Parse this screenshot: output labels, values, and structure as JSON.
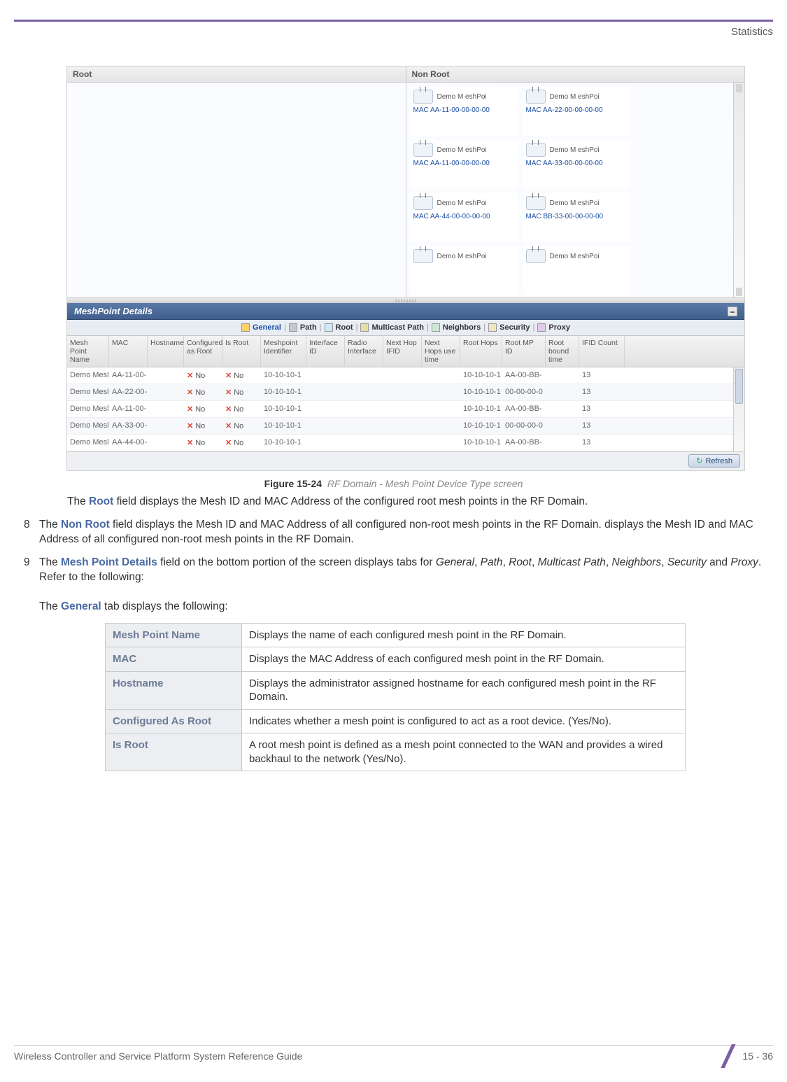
{
  "header": {
    "section": "Statistics"
  },
  "screenshot": {
    "panes": {
      "root": {
        "title": "Root"
      },
      "nonroot": {
        "title": "Non Root",
        "cards": [
          {
            "name": "Demo M eshPoi",
            "mac": "MAC AA-11-00-00-00-00"
          },
          {
            "name": "Demo M eshPoi",
            "mac": "MAC AA-22-00-00-00-00"
          },
          {
            "name": "Demo M eshPoi",
            "mac": "MAC AA-11-00-00-00-00"
          },
          {
            "name": "Demo M eshPoi",
            "mac": "MAC AA-33-00-00-00-00"
          },
          {
            "name": "Demo M eshPoi",
            "mac": "MAC AA-44-00-00-00-00"
          },
          {
            "name": "Demo M eshPoi",
            "mac": "MAC BB-33-00-00-00-00"
          },
          {
            "name": "Demo M eshPoi",
            "mac": ""
          },
          {
            "name": "Demo M eshPoi",
            "mac": ""
          }
        ]
      }
    },
    "details": {
      "title": "MeshPoint Details",
      "tabs": {
        "general": "General",
        "path": "Path",
        "root": "Root",
        "multicast": "Multicast Path",
        "neighbors": "Neighbors",
        "security": "Security",
        "proxy": "Proxy"
      },
      "columns": [
        "Mesh Point Name",
        "MAC",
        "Hostname",
        "Configured as Root",
        "Is Root",
        "Meshpoint Identifier",
        "Interface ID",
        "Radio Interface",
        "Next Hop IFID",
        "Next Hops use time",
        "Root Hops",
        "Root MP ID",
        "Root bound time",
        "IFID Count"
      ],
      "rows": [
        {
          "name": "Demo Mesl",
          "mac": "AA-11-00-",
          "cfg": "No",
          "isroot": "No",
          "mpid": "10-10-10-1",
          "rhops": "10-10-10-1",
          "rmp": "AA-00-BB-",
          "ifid": "13"
        },
        {
          "name": "Demo Mesl",
          "mac": "AA-22-00-",
          "cfg": "No",
          "isroot": "No",
          "mpid": "10-10-10-1",
          "rhops": "10-10-10-1",
          "rmp": "00-00-00-0",
          "ifid": "13"
        },
        {
          "name": "Demo Mesl",
          "mac": "AA-11-00-",
          "cfg": "No",
          "isroot": "No",
          "mpid": "10-10-10-1",
          "rhops": "10-10-10-1",
          "rmp": "AA-00-BB-",
          "ifid": "13"
        },
        {
          "name": "Demo Mesl",
          "mac": "AA-33-00-",
          "cfg": "No",
          "isroot": "No",
          "mpid": "10-10-10-1",
          "rhops": "10-10-10-1",
          "rmp": "00-00-00-0",
          "ifid": "13"
        },
        {
          "name": "Demo Mesl",
          "mac": "AA-44-00-",
          "cfg": "No",
          "isroot": "No",
          "mpid": "10-10-10-1",
          "rhops": "10-10-10-1",
          "rmp": "AA-00-BB-",
          "ifid": "13"
        }
      ],
      "refresh": "Refresh"
    }
  },
  "caption": {
    "label": "Figure 15-24",
    "text": "RF Domain - Mesh Point Device Type screen"
  },
  "paras": {
    "p7": {
      "pre": "The ",
      "b": "Root",
      "post": " field displays the Mesh ID and MAC Address of the configured root mesh points in the RF Domain."
    },
    "p8": {
      "n": "8",
      "pre": "The ",
      "b": "Non Root",
      "post": " field displays the Mesh ID and MAC Address of all configured non-root mesh points in the RF Domain. displays the Mesh ID and MAC Address of all configured non-root mesh points in the RF Domain."
    },
    "p9": {
      "n": "9",
      "pre": "The ",
      "b": "Mesh Point Details",
      "mid": " field on the bottom portion of the screen displays tabs for ",
      "i1": "General",
      "c1": ", ",
      "i2": "Path",
      "c2": ", ",
      "i3": "Root",
      "c3": ", ",
      "i4": "Multicast Path",
      "c4": ", ",
      "i5": "Neighbors",
      "c5": ", ",
      "i6": "Security",
      "c6": " and ",
      "i7": "Proxy",
      "post": ". Refer to the following:"
    },
    "p9b": {
      "pre": "The ",
      "b": "General",
      "post": " tab displays the following:"
    }
  },
  "defs": [
    {
      "k": "Mesh Point Name",
      "v": "Displays the name of each configured mesh point in the RF Domain."
    },
    {
      "k": "MAC",
      "v": "Displays the MAC Address of each configured mesh point in the RF Domain."
    },
    {
      "k": "Hostname",
      "v": "Displays the administrator assigned hostname for each configured mesh point in the RF Domain."
    },
    {
      "k": "Configured As Root",
      "v": "Indicates whether a mesh point is configured to act as a root device. (Yes/No)."
    },
    {
      "k": "Is Root",
      "v": "A root mesh point is defined as a mesh point connected to the WAN and provides a wired backhaul to the network (Yes/No)."
    }
  ],
  "footer": {
    "guide": "Wireless Controller and Service Platform System Reference Guide",
    "page": "15 - 36"
  }
}
